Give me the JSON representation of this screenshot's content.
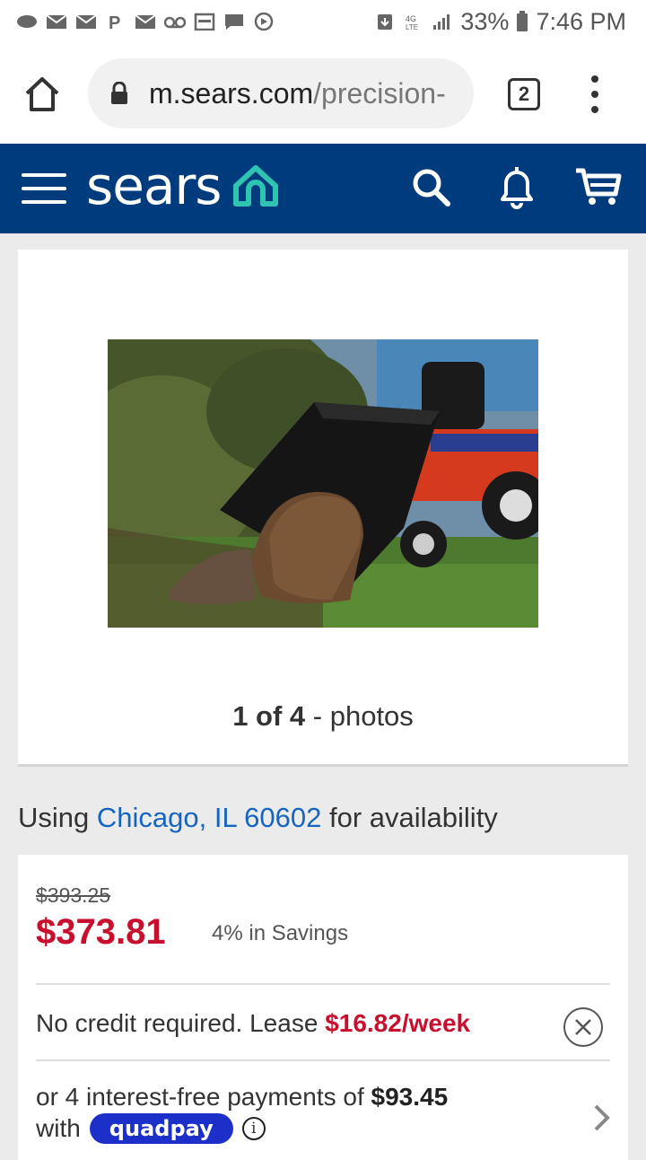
{
  "status_bar": {
    "battery": "33%",
    "time": "7:46 PM",
    "left_icons": [
      "sync-icon",
      "mail-icon",
      "mail-icon",
      "paypal-icon",
      "mail-icon",
      "voicemail-icon",
      "calendar-icon",
      "chat-icon",
      "play-icon"
    ],
    "right_icons": [
      "download-icon",
      "lte-icon",
      "signal-icon",
      "battery-icon"
    ]
  },
  "browser": {
    "url_domain": "m.sears.com",
    "url_path": "/precision-",
    "tab_count": "2"
  },
  "nav": {
    "logo": "sears",
    "accent": "#2fc4b2",
    "bg": "#003b7e"
  },
  "gallery": {
    "counter": "1 of 4",
    "suffix": "- photos"
  },
  "availability": {
    "prefix": "Using",
    "location": "Chicago, IL 60602",
    "suffix": "for availability"
  },
  "pricing": {
    "old_price": "$393.25",
    "price": "$373.81",
    "savings": "4% in Savings",
    "lease_text": "No credit required. Lease",
    "lease_amount": "$16.82/week",
    "installments_text": "or 4 interest-free payments of",
    "installment_amount": "$93.45",
    "with": "with",
    "quadpay": "quadpay",
    "price_color": "#c8102e"
  }
}
